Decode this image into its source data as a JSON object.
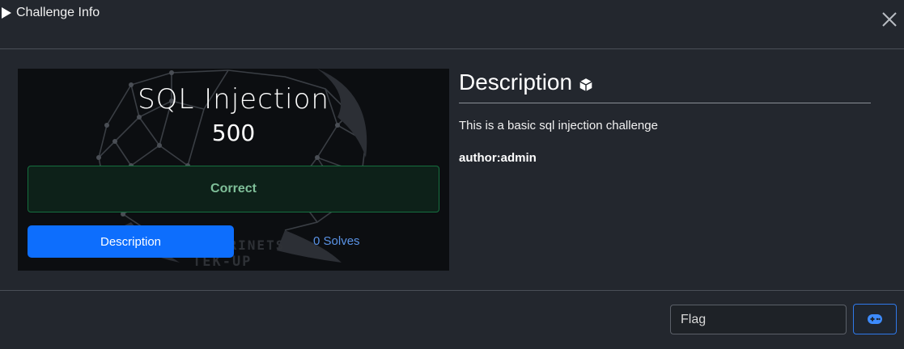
{
  "header": {
    "title": "Challenge Info",
    "play_icon": "play-icon",
    "close_icon": "close-icon"
  },
  "challenge": {
    "name": "SQL Injection",
    "value": "500",
    "status": "Correct",
    "description_button": "Description",
    "solves": "0 Solves",
    "logo_lines": [
      "SECURINETS",
      "TEK-UP"
    ]
  },
  "description": {
    "heading": "Description",
    "heading_icon": "cube-icon",
    "text": "This is a basic sql injection challenge",
    "author": "author:admin"
  },
  "footer": {
    "flag_placeholder": "Flag",
    "submit_icon": "gamepad-icon"
  },
  "colors": {
    "background": "#23272e",
    "primary": "#0d6efd",
    "success_border": "#16703f",
    "success_text": "#7fbf99",
    "link": "#5a93e6"
  }
}
